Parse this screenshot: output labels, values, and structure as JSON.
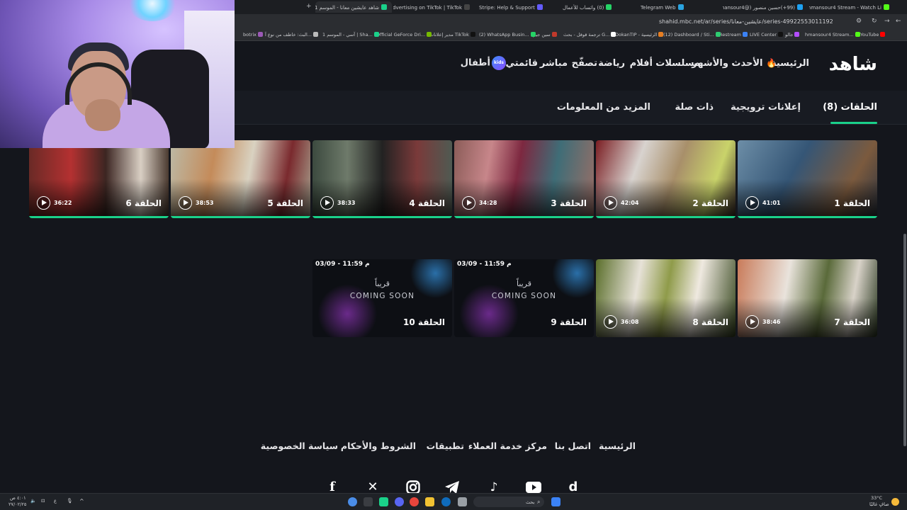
{
  "browser": {
    "tabs": [
      {
        "label": "hmansour4 Stream - Watch Li...",
        "active": false,
        "color": "#53fc18"
      },
      {
        "label": "(99+)حسين منصور (@hmansour4)...",
        "active": false,
        "color": "#1da1f2"
      },
      {
        "label": "Telegram Web",
        "active": false,
        "color": "#2aa3e0"
      },
      {
        "label": "(0) واتساب للأعمال",
        "active": false,
        "color": "#25d366"
      },
      {
        "label": "Stripe: Help & Support",
        "active": false,
        "color": "#635bff"
      },
      {
        "label": "Advertising on TikTok | TikTok...",
        "active": false,
        "color": "#111111"
      },
      {
        "label": "شاهد عايشين معانا - الموسم 1 |...",
        "active": true,
        "color": "#1ad18a"
      }
    ],
    "url": "shahid.mbc.net/ar/series/عايشين-معانا/series-49922553011192",
    "bookmarks": [
      {
        "label": "YouTube",
        "color": "#ff0000"
      },
      {
        "label": "hmansour4 Stream...",
        "color": "#53fc18"
      },
      {
        "label": "جالو",
        "color": "#b34dff"
      },
      {
        "label": "LIVE Center",
        "color": "#111111"
      },
      {
        "label": "Restream",
        "color": "#3b82f6"
      },
      {
        "label": "(12) Dashboard / Sti...",
        "color": "#2ecc71"
      },
      {
        "label": "DokanTIP - الرئيسية",
        "color": "#e67e22"
      },
      {
        "label": "ترجمة قوقل - بحث G...",
        "color": "#ffffff"
      },
      {
        "label": "سين جيم",
        "color": "#c0392b"
      },
      {
        "label": "(2) WhatsApp Busin...",
        "color": "#25d366"
      },
      {
        "label": "مدير إعلانات TikTok",
        "color": "#111111"
      },
      {
        "label": "Official GeForce Dri...",
        "color": "#76b900"
      },
      {
        "label": "آسي - الموسم 1 | Sha...",
        "color": "#1ad18a"
      },
      {
        "label": "البث: خاطف من نوع آ...",
        "color": "#bbbbbb"
      },
      {
        "label": "botrix",
        "color": "#9b59b6"
      }
    ]
  },
  "site": {
    "logo": "شاهد",
    "nav": [
      "الرئيسية",
      "الأحدث والأشهر",
      "مسلسلات",
      "أفلام",
      "رياضة",
      "تصفّح",
      "مباشر",
      "قائمتي",
      "أطفال"
    ],
    "kids_badge": "kids",
    "accent": "#1ad18a",
    "tabs": [
      "الحلقات (8)",
      "إعلانات ترويجية",
      "ذات صلة",
      "المزيد من المعلومات"
    ]
  },
  "episodes": [
    {
      "title": "الحلقة 1",
      "duration": "41:01",
      "watched": true
    },
    {
      "title": "الحلقة 2",
      "duration": "42:04",
      "watched": true
    },
    {
      "title": "الحلقة 3",
      "duration": "34:28",
      "watched": true
    },
    {
      "title": "الحلقة 4",
      "duration": "38:33",
      "watched": true
    },
    {
      "title": "الحلقة 5",
      "duration": "38:53",
      "watched": true
    },
    {
      "title": "الحلقة 6",
      "duration": "36:22",
      "watched": true
    },
    {
      "title": "الحلقة 7",
      "duration": "38:46",
      "watched": false
    },
    {
      "title": "الحلقة 8",
      "duration": "36:08",
      "watched": false
    },
    {
      "title": "الحلقة 9",
      "coming_soon": true,
      "date": "03/09 - 11:59 م",
      "soon_ar": "قريباً",
      "soon_en": "COMING SOON"
    },
    {
      "title": "الحلقة 10",
      "coming_soon": true,
      "date": "03/09 - 11:59 م",
      "soon_ar": "قريباً",
      "soon_en": "COMING SOON"
    }
  ],
  "footer": {
    "links": [
      "الرئيسية",
      "اتصل بنا",
      "مركز خدمة العملاء",
      "تطبيقات",
      "الشروط والأحكام",
      "سياسة الخصوصية"
    ],
    "social": [
      "shahid-d-icon",
      "youtube-icon",
      "tiktok-icon",
      "telegram-icon",
      "instagram-icon",
      "x-icon",
      "facebook-icon"
    ]
  },
  "taskbar": {
    "search_placeholder": "بحث",
    "weather": "33°C",
    "weather_desc": "صافٍ غالبًا",
    "time": "٤:٠١ ص",
    "date": "٢٧/٠٢/٢٥"
  }
}
